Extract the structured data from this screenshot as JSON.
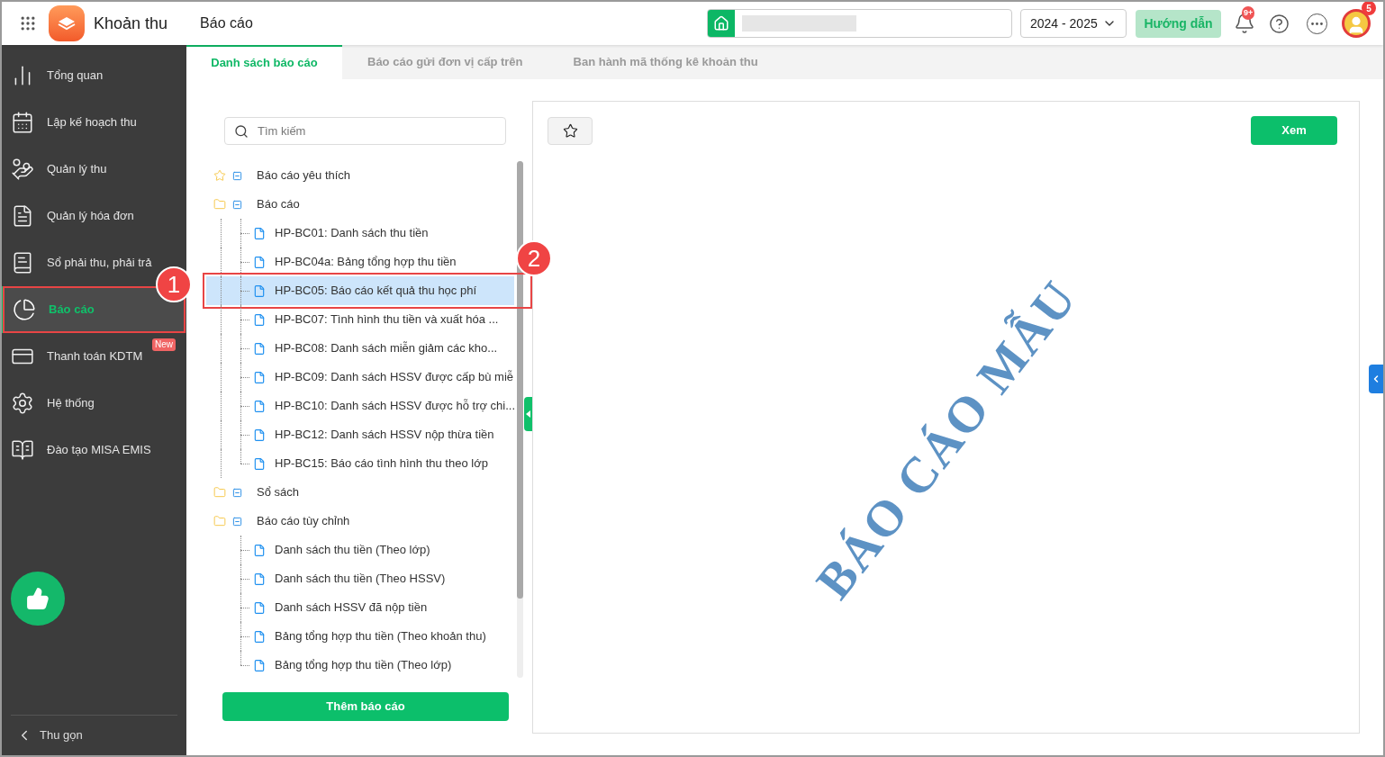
{
  "header": {
    "app_name": "Khoản thu",
    "page_title": "Báo cáo",
    "year_select": {
      "value": "2024 - 2025"
    },
    "guide_button": "Hướng dẫn",
    "notification_badge": "9+",
    "avatar_badge": "5"
  },
  "sidebar": {
    "items": [
      {
        "label": "Tổng quan",
        "selected": false
      },
      {
        "label": "Lập kế hoạch thu",
        "selected": false
      },
      {
        "label": "Quản lý thu",
        "selected": false
      },
      {
        "label": "Quản lý hóa đơn",
        "selected": false
      },
      {
        "label": "Sổ phải thu, phải trả",
        "selected": false
      },
      {
        "label": "Báo cáo",
        "selected": true
      },
      {
        "label": "Thanh toán KDTM",
        "selected": false,
        "badge": "New"
      },
      {
        "label": "Hệ thống",
        "selected": false
      },
      {
        "label": "Đào tạo MISA EMIS",
        "selected": false
      }
    ],
    "collapse": "Thu gọn"
  },
  "tabs": [
    {
      "label": "Danh sách báo cáo",
      "selected": true
    },
    {
      "label": "Báo cáo gửi đơn vị cấp trên",
      "selected": false
    },
    {
      "label": "Ban hành mã thống kê khoản thu",
      "selected": false
    }
  ],
  "search": {
    "placeholder": "Tìm kiếm"
  },
  "tree": [
    {
      "kind": "favorites",
      "label": "Báo cáo yêu thích",
      "expanded": true
    },
    {
      "kind": "folder",
      "label": "Báo cáo",
      "expanded": true,
      "children": [
        {
          "label": "HP-BC01: Danh sách thu tiền",
          "selected": false
        },
        {
          "label": "HP-BC04a: Bảng tổng hợp thu tiền",
          "selected": false
        },
        {
          "label": "HP-BC05: Báo cáo kết quả thu học phí",
          "selected": true
        },
        {
          "label": "HP-BC07: Tình hình thu tiền và xuất hóa ...",
          "selected": false
        },
        {
          "label": "HP-BC08: Danh sách miễn giảm các kho...",
          "selected": false
        },
        {
          "label": "HP-BC09: Danh sách HSSV được cấp bù miễ",
          "selected": false
        },
        {
          "label": "HP-BC10: Danh sách HSSV được hỗ trợ chi...",
          "selected": false
        },
        {
          "label": "HP-BC12: Danh sách HSSV nộp thừa tiền",
          "selected": false
        },
        {
          "label": "HP-BC15: Báo cáo tình hình thu theo lớp",
          "selected": false
        }
      ]
    },
    {
      "kind": "folder",
      "label": "Sổ sách",
      "expanded": true
    },
    {
      "kind": "folder",
      "label": "Báo cáo tùy chỉnh",
      "expanded": true,
      "children": [
        {
          "label": "Danh sách thu tiền (Theo lớp)",
          "selected": false
        },
        {
          "label": "Danh sách thu tiền (Theo HSSV)",
          "selected": false
        },
        {
          "label": "Danh sách HSSV đã nộp tiền",
          "selected": false
        },
        {
          "label": "Bảng tổng hợp thu tiền (Theo khoản thu)",
          "selected": false
        },
        {
          "label": "Bảng tổng hợp thu tiền (Theo lớp)",
          "selected": false
        }
      ]
    }
  ],
  "add_button": "Thêm báo cáo",
  "preview": {
    "view_button": "Xem",
    "watermark": "BÁO CÁO MẪU"
  },
  "annotations": [
    {
      "label": "1"
    },
    {
      "label": "2"
    }
  ]
}
